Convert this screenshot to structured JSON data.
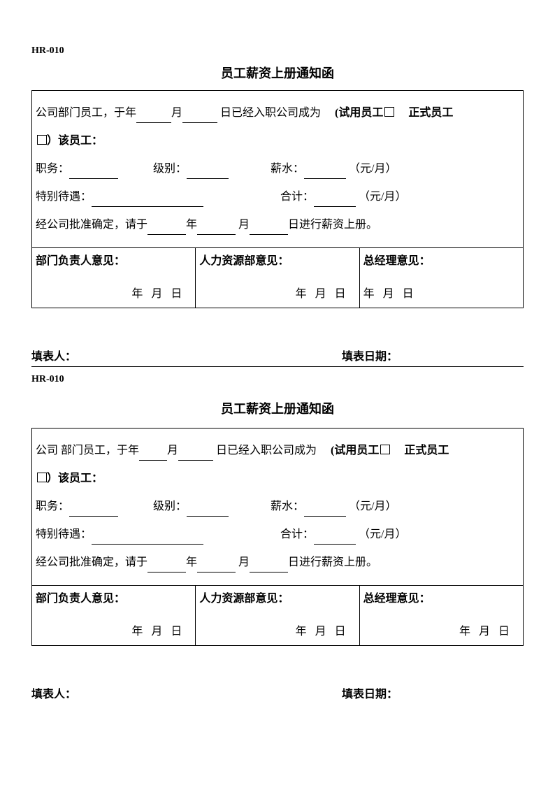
{
  "form_code": "HR-010",
  "title": "员工薪资上册通知函",
  "body": {
    "line1_a": "公司部门员工，于年",
    "line1_a2": "公司 部门员工，于年",
    "month": "月",
    "line1_b": "日已经入职公司成为",
    "trial_label": "(试用员工",
    "formal_label": "正式员工",
    "line1_c": "）该员工：",
    "position_label": "职务：",
    "level_label": "级别：",
    "salary_label": "薪水：",
    "unit": "（元/月）",
    "special_label": "特别待遇：",
    "total_label": "合计：",
    "line_last_a": "经公司批准确定，请于",
    "year": "年",
    "month2": "月",
    "line_last_b": "日进行薪资上册。"
  },
  "approvals": {
    "dept": "部门负责人意见：",
    "hr": "人力资源部意见：",
    "gm": "总经理意见：",
    "date": "年 月 日"
  },
  "footer": {
    "filler": "填表人：",
    "date": "填表日期："
  }
}
